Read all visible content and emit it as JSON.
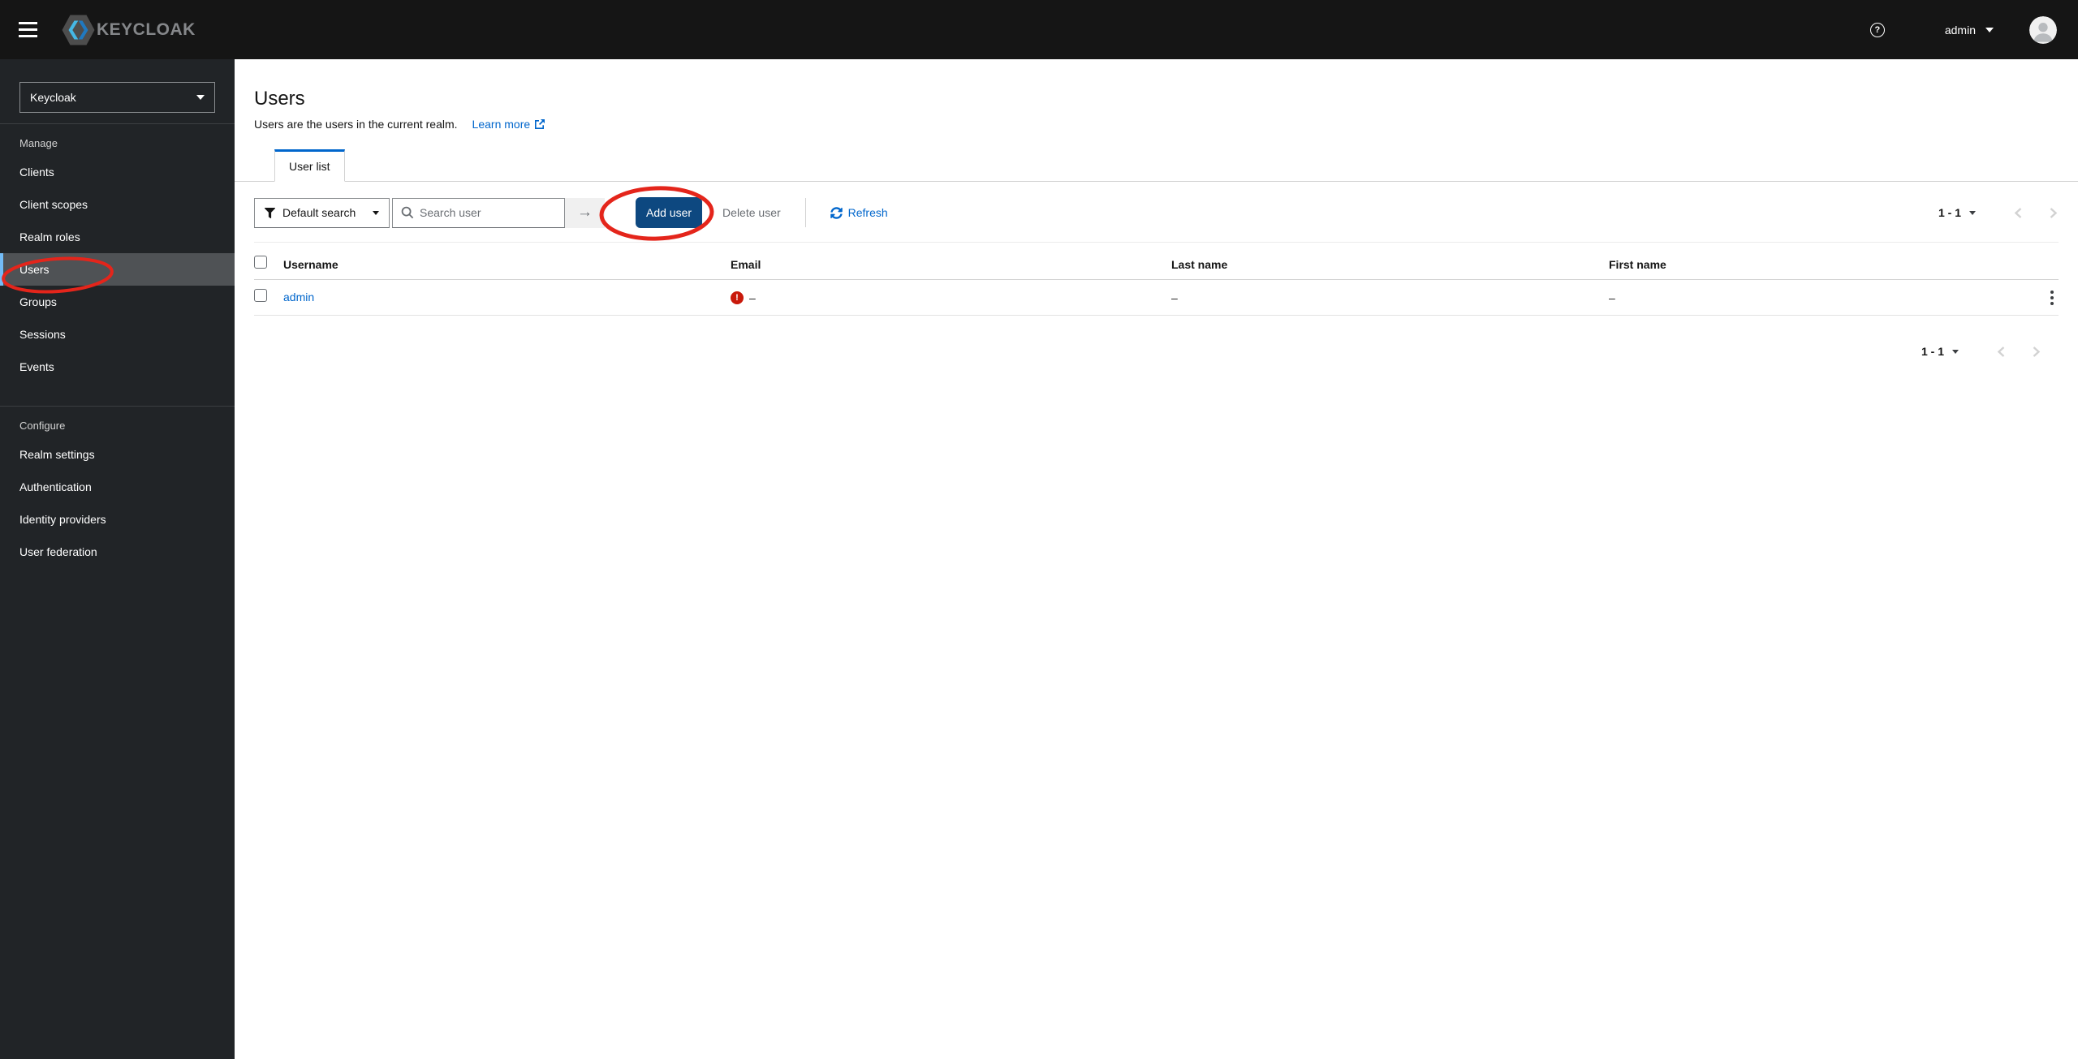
{
  "colors": {
    "accent_blue": "#0066cc",
    "primary_button_blue": "#0d4880",
    "warning_red": "#c9190b",
    "annotation_red": "#e4251b",
    "masthead_bg": "#151515",
    "sidebar_bg": "#212427",
    "sidebar_selected_bg": "#4f5255",
    "sidebar_selected_border": "#73bcf7"
  },
  "masthead": {
    "brand": "KEYCLOAK",
    "help_icon": "?",
    "user": {
      "name": "admin"
    }
  },
  "sidebar": {
    "realm_selector": {
      "value": "Keycloak"
    },
    "groups": [
      {
        "label": "Manage",
        "items": [
          {
            "label": "Clients"
          },
          {
            "label": "Client scopes"
          },
          {
            "label": "Realm roles"
          },
          {
            "label": "Users",
            "active": true
          },
          {
            "label": "Groups"
          },
          {
            "label": "Sessions"
          },
          {
            "label": "Events"
          }
        ]
      },
      {
        "label": "Configure",
        "items": [
          {
            "label": "Realm settings"
          },
          {
            "label": "Authentication"
          },
          {
            "label": "Identity providers"
          },
          {
            "label": "User federation"
          }
        ]
      }
    ]
  },
  "page": {
    "title": "Users",
    "description": "Users are the users in the current realm.",
    "learn_more_label": "Learn more"
  },
  "tabs": [
    {
      "label": "User list",
      "active": true
    }
  ],
  "toolbar": {
    "filter_dropdown": {
      "label": "Default search"
    },
    "search": {
      "placeholder": "Search user"
    },
    "arrow_button": "→",
    "add_user_label": "Add user",
    "delete_user_label": "Delete user",
    "refresh_label": "Refresh",
    "pagination": {
      "range": "1 - 1"
    }
  },
  "table": {
    "columns": [
      "Username",
      "Email",
      "Last name",
      "First name"
    ],
    "rows": [
      {
        "username": "admin",
        "email_warning": "!",
        "email": "–",
        "last_name": "–",
        "first_name": "–"
      }
    ]
  },
  "footer_pagination": {
    "range": "1 - 1"
  }
}
